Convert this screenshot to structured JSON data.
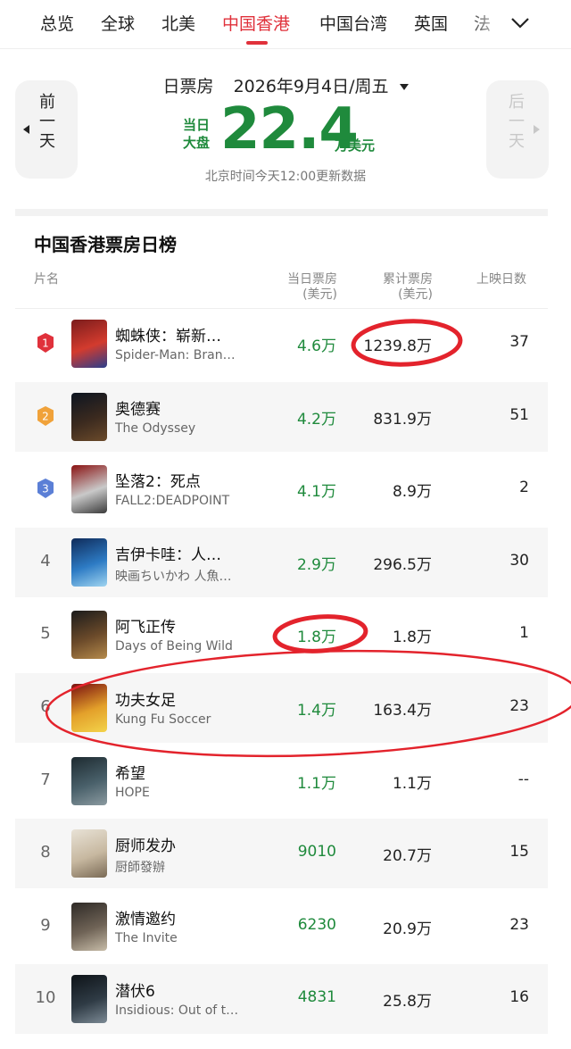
{
  "tabs": {
    "items": [
      {
        "label": "总览"
      },
      {
        "label": "全球"
      },
      {
        "label": "北美"
      },
      {
        "label": "中国香港",
        "active": true
      },
      {
        "label": "中国台湾"
      },
      {
        "label": "英国"
      },
      {
        "label": "法"
      }
    ],
    "more_icon": "chevron-down-icon"
  },
  "header": {
    "prev_day_label": "前一天",
    "next_day_label": "后一天",
    "box_office_type": "日票房",
    "date": "2026年9月4日/周五",
    "total_label": "当日大盘",
    "total_value": "22.4",
    "total_unit": "万美元",
    "update_note": "北京时间今天12:00更新数据"
  },
  "ranking": {
    "title": "中国香港票房日榜",
    "columns": {
      "name": "片名",
      "daily": "当日票房",
      "daily_unit": "(美元)",
      "cumulative": "累计票房",
      "cumulative_unit": "(美元)",
      "days": "上映日数"
    },
    "rows": [
      {
        "rank": "1",
        "title_cn": "蜘蛛侠：崭新…",
        "title_en": "Spider-Man: Bran…",
        "daily": "4.6万",
        "cumulative": "1239.8万",
        "days": "37"
      },
      {
        "rank": "2",
        "title_cn": "奥德赛",
        "title_en": "The Odyssey",
        "daily": "4.2万",
        "cumulative": "831.9万",
        "days": "51"
      },
      {
        "rank": "3",
        "title_cn": "坠落2：死点",
        "title_en": "FALL2:DEADPOINT",
        "daily": "4.1万",
        "cumulative": "8.9万",
        "days": "2"
      },
      {
        "rank": "4",
        "title_cn": "吉伊卡哇：人…",
        "title_en": "映画ちいかわ 人魚…",
        "daily": "2.9万",
        "cumulative": "296.5万",
        "days": "30"
      },
      {
        "rank": "5",
        "title_cn": "阿飞正传",
        "title_en": "Days of Being Wild",
        "daily": "1.8万",
        "cumulative": "1.8万",
        "days": "1"
      },
      {
        "rank": "6",
        "title_cn": "功夫女足",
        "title_en": "Kung Fu Soccer",
        "daily": "1.4万",
        "cumulative": "163.4万",
        "days": "23"
      },
      {
        "rank": "7",
        "title_cn": "希望",
        "title_en": "HOPE",
        "daily": "1.1万",
        "cumulative": "1.1万",
        "days": "--"
      },
      {
        "rank": "8",
        "title_cn": "厨师发办",
        "title_en": "厨師發辦",
        "daily": "9010",
        "cumulative": "20.7万",
        "days": "15"
      },
      {
        "rank": "9",
        "title_cn": "激情邀约",
        "title_en": "The Invite",
        "daily": "6230",
        "cumulative": "20.9万",
        "days": "23"
      },
      {
        "rank": "10",
        "title_cn": "潜伏6",
        "title_en": "Insidious: Out of t…",
        "daily": "4831",
        "cumulative": "25.8万",
        "days": "16"
      }
    ]
  },
  "colors": {
    "accent_red": "#e0313b",
    "box_office_green": "#1f8a3c",
    "annotation_red": "#e3232c",
    "badge_gold": "#f0a23a",
    "badge_blue": "#5b7fd6"
  }
}
